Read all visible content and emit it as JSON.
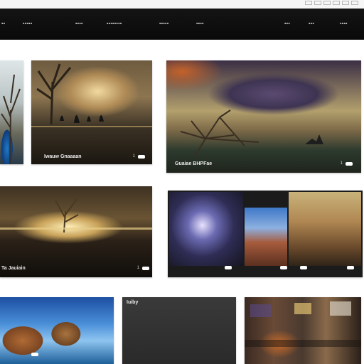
{
  "navbar": {
    "items_left": [
      "▪▪",
      "▪▪▪▪▪",
      "▪▪▪▪",
      "▪▪▪▪▪▪▪▪",
      "▪▪▪▪▪",
      "▪▪▪▪"
    ],
    "items_right": [
      "▪▪▪",
      "▪▪▪",
      "▪▪▪▪"
    ]
  },
  "cards": [
    {
      "id": "c1",
      "caption": "",
      "count": ""
    },
    {
      "id": "c2",
      "caption": "Iwauw Gnaaaan",
      "count": "1"
    },
    {
      "id": "c3",
      "caption": "Guaiae BHPFae",
      "count": "1"
    },
    {
      "id": "c4",
      "caption": "Ta Jauiain",
      "count": "1"
    },
    {
      "id": "c5",
      "caption": "",
      "count": ""
    },
    {
      "id": "c6",
      "caption": "",
      "count": ""
    },
    {
      "id": "c7",
      "caption": "Iuiby",
      "count": ""
    },
    {
      "id": "c8",
      "caption": "",
      "count": ""
    }
  ],
  "colors": {
    "navbar": "#111111",
    "background": "#ffffff",
    "caption_text": "#eaeaea"
  }
}
